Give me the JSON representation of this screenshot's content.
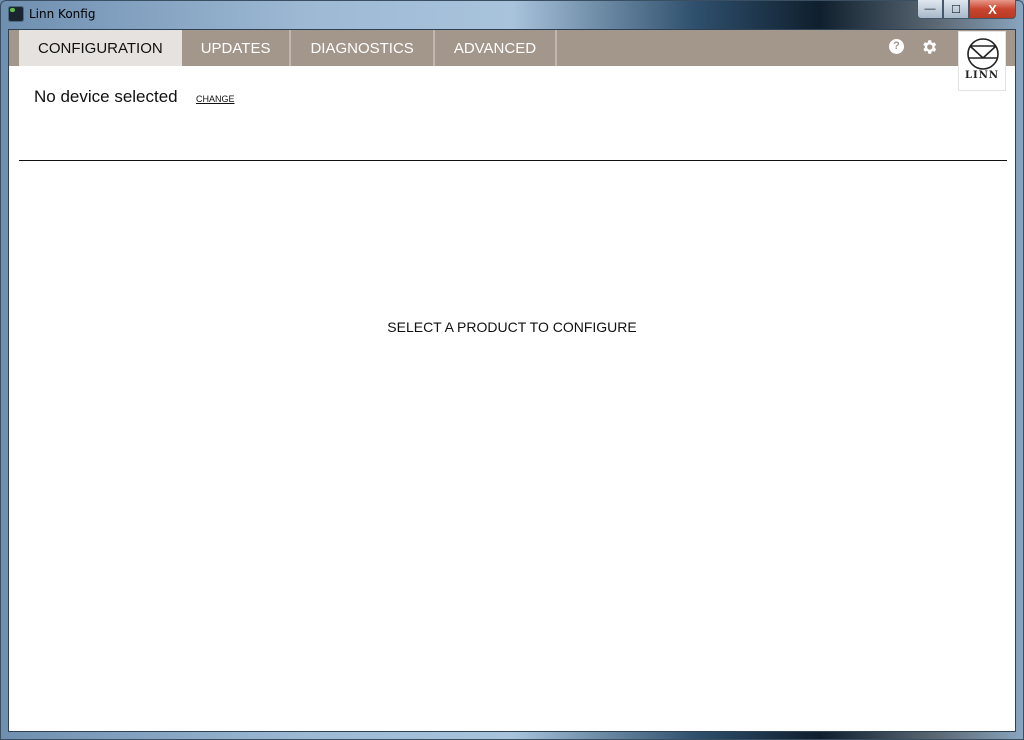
{
  "window": {
    "title": "Linn Konfig",
    "controls": {
      "minimize": "—",
      "maximize": "☐",
      "close": "X"
    }
  },
  "nav": {
    "tabs": [
      {
        "label": "CONFIGURATION",
        "active": true
      },
      {
        "label": "UPDATES",
        "active": false
      },
      {
        "label": "DIAGNOSTICS",
        "active": false
      },
      {
        "label": "ADVANCED",
        "active": false
      }
    ],
    "help_icon": "?",
    "logo_text": "LINN"
  },
  "device": {
    "status": "No device selected",
    "change_label": "CHANGE"
  },
  "main": {
    "message": "SELECT A PRODUCT TO CONFIGURE"
  },
  "colors": {
    "nav_bg": "#a3968b",
    "active_tab_bg": "#e6e2df"
  }
}
